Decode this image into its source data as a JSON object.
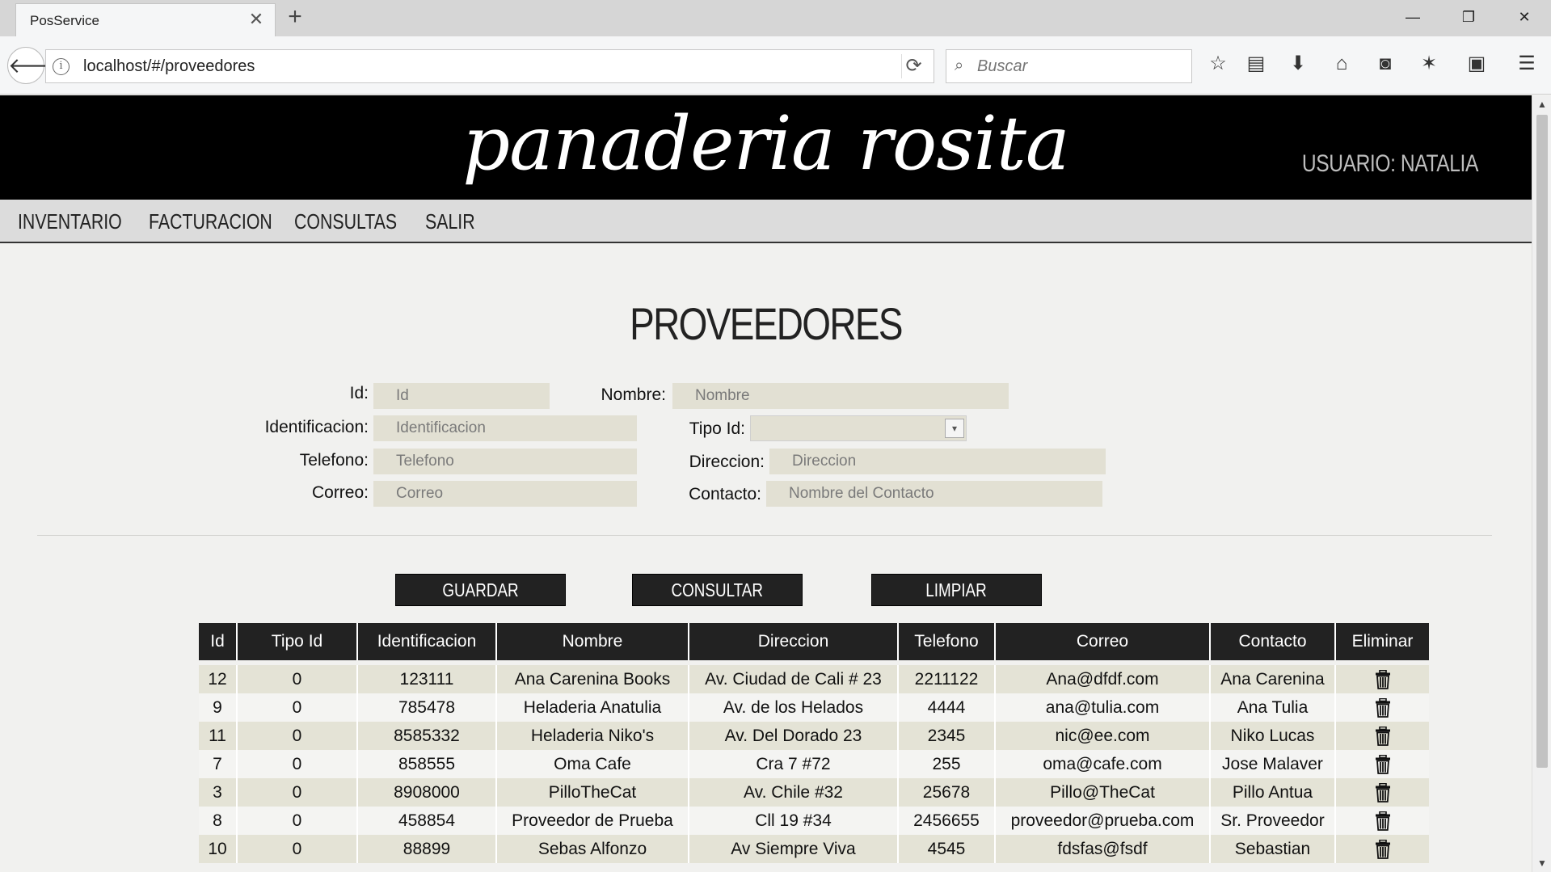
{
  "browser": {
    "tab_title": "PosService",
    "tab_close": "✕",
    "new_tab": "+",
    "url": "localhost/#/proveedores",
    "search_placeholder": "Buscar",
    "window_controls": {
      "minimize": "—",
      "restore": "❐",
      "close": "✕"
    },
    "icons": [
      "back-arrow-icon",
      "info-icon",
      "reload-icon",
      "search-icon",
      "bookmark-star-icon",
      "reader-list-icon",
      "download-icon",
      "home-icon",
      "pocket-icon",
      "addon-icon",
      "extension-icon",
      "menu-icon"
    ]
  },
  "site": {
    "brand": "panaderia rosita",
    "user_label": "USUARIO: NATALIA",
    "nav": [
      "INVENTARIO",
      "FACTURACION",
      "CONSULTAS",
      "SALIR"
    ]
  },
  "page": {
    "title": "PROVEEDORES",
    "form": {
      "id_label": "Id:",
      "id_placeholder": "Id",
      "nombre_label": "Nombre:",
      "nombre_placeholder": "Nombre",
      "identificacion_label": "Identificacion:",
      "identificacion_placeholder": "Identificacion",
      "tipo_id_label": "Tipo Id:",
      "tipo_id_value": "",
      "telefono_label": "Telefono:",
      "telefono_placeholder": "Telefono",
      "direccion_label": "Direccion:",
      "direccion_placeholder": "Direccion",
      "correo_label": "Correo:",
      "correo_placeholder": "Correo",
      "contacto_label": "Contacto:",
      "contacto_placeholder": "Nombre del Contacto"
    },
    "buttons": {
      "guardar": "GUARDAR",
      "consultar": "CONSULTAR",
      "limpiar": "LIMPIAR"
    },
    "table": {
      "headers": [
        "Id",
        "Tipo Id",
        "Identificacion",
        "Nombre",
        "Direccion",
        "Telefono",
        "Correo",
        "Contacto",
        "Eliminar"
      ],
      "rows": [
        [
          "12",
          "0",
          "123111",
          "Ana Carenina Books",
          "Av. Ciudad de Cali # 23",
          "2211122",
          "Ana@dfdf.com",
          "Ana Carenina"
        ],
        [
          "9",
          "0",
          "785478",
          "Heladeria Anatulia",
          "Av. de los Helados",
          "4444",
          "ana@tulia.com",
          "Ana Tulia"
        ],
        [
          "11",
          "0",
          "8585332",
          "Heladeria Niko's",
          "Av. Del Dorado 23",
          "2345",
          "nic@ee.com",
          "Niko Lucas"
        ],
        [
          "7",
          "0",
          "858555",
          "Oma Cafe",
          "Cra 7 #72",
          "255",
          "oma@cafe.com",
          "Jose Malaver"
        ],
        [
          "3",
          "0",
          "8908000",
          "PilloTheCat",
          "Av. Chile #32",
          "25678",
          "Pillo@TheCat",
          "Pillo Antua"
        ],
        [
          "8",
          "0",
          "458854",
          "Proveedor de Prueba",
          "Cll 19 #34",
          "2456655",
          "proveedor@prueba.com",
          "Sr. Proveedor"
        ],
        [
          "10",
          "0",
          "88899",
          "Sebas Alfonzo",
          "Av Siempre Viva",
          "4545",
          "fdsfas@fsdf",
          "Sebastian"
        ]
      ],
      "delete_icon": "trash-icon"
    }
  },
  "colors": {
    "header_bg": "#000000",
    "nav_bg": "#dcdcdc",
    "table_header_bg": "#222222",
    "row_odd": "#e4e3d6",
    "row_even": "#f4f4f2",
    "input_bg": "#e2e0d3"
  }
}
